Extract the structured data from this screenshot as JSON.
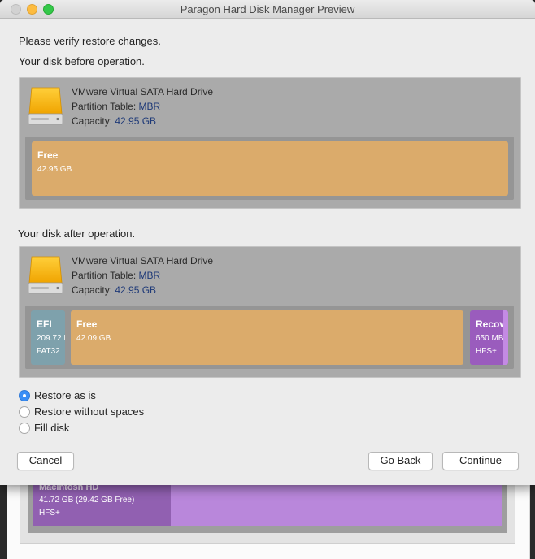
{
  "window": {
    "title": "Paragon Hard Disk Manager Preview"
  },
  "intro": {
    "verify_text": "Please verify restore changes.",
    "before_text": "Your disk before operation.",
    "after_text": "Your disk after operation."
  },
  "disk_before": {
    "name": "VMware Virtual SATA Hard Drive",
    "partition_table_label": "Partition Table: ",
    "partition_table_value": "MBR",
    "capacity_label": "Capacity: ",
    "capacity_value": "42.95 GB",
    "partitions": [
      {
        "name": "Free",
        "size": "42.95 GB",
        "fs": ""
      }
    ]
  },
  "disk_after": {
    "name": "VMware Virtual SATA Hard Drive",
    "partition_table_label": "Partition Table: ",
    "partition_table_value": "MBR",
    "capacity_label": "Capacity: ",
    "capacity_value": "42.95 GB",
    "partitions": [
      {
        "name": "EFI",
        "size": "209.72 I",
        "fs": "FAT32"
      },
      {
        "name": "Free",
        "size": "42.09 GB",
        "fs": ""
      },
      {
        "name": "Recove",
        "size": "650 MB (",
        "fs": "HFS+"
      }
    ]
  },
  "restore_options": {
    "selected": "Restore as is",
    "items": [
      "Restore as is",
      "Restore without spaces",
      "Fill disk"
    ]
  },
  "buttons": {
    "cancel": "Cancel",
    "go_back": "Go Back",
    "continue": "Continue"
  },
  "background_window": {
    "partition_name": "Macintosh HD",
    "partition_size": "41.72 GB (29.42 GB Free)",
    "partition_fs": "HFS+"
  },
  "colors": {
    "free_partition": "#dbab6b",
    "efi_partition": "#7ea1ac",
    "recovery_partition": "#9a5cbd",
    "radio_selected": "#3a8ef6"
  }
}
